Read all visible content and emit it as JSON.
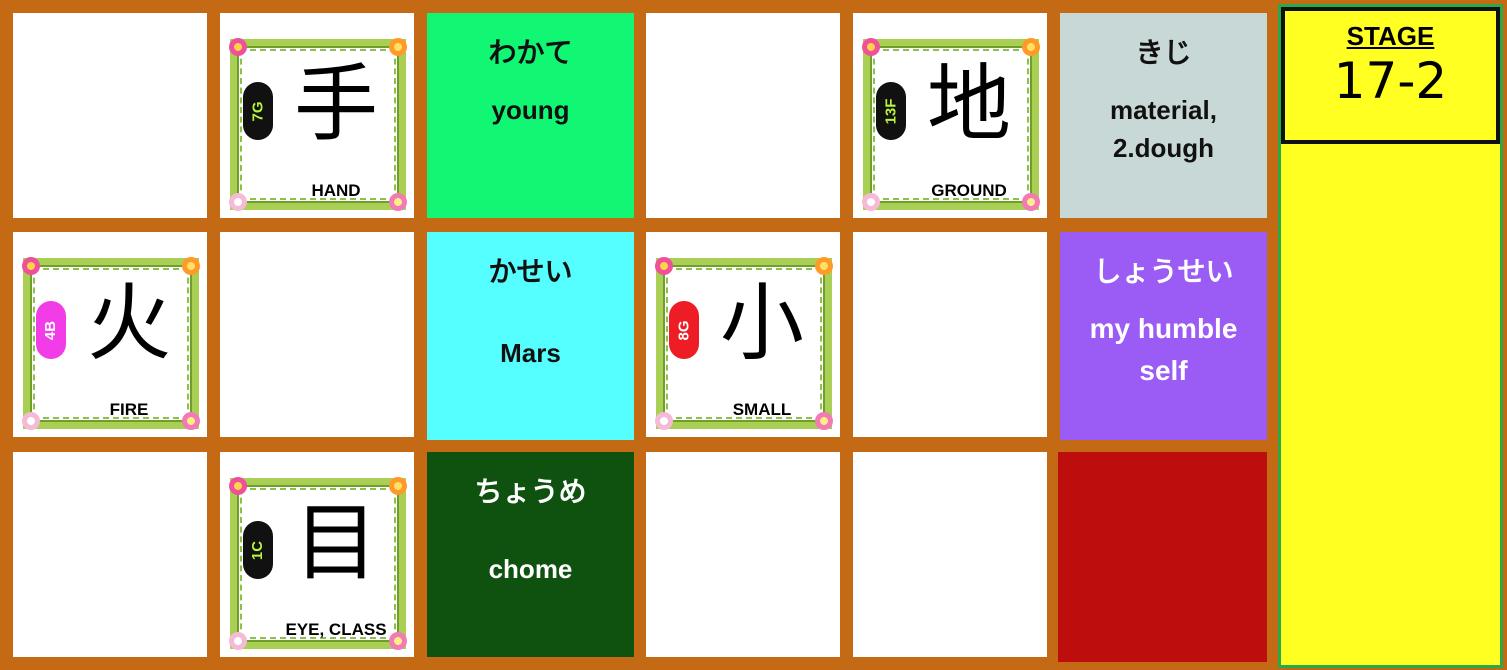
{
  "tiles": {
    "r0c2": {
      "kana": "わかて",
      "meaning": "young",
      "bg": "#11f774",
      "fg": "#111111"
    },
    "r0c5": {
      "kana": "きじ",
      "meaning": "material, 2.dough",
      "bg": "#c8d8d6",
      "fg": "#111111"
    },
    "r1c2": {
      "kana": "かせい",
      "meaning": "Mars",
      "bg": "#55ffff",
      "fg": "#111111"
    },
    "r1c5": {
      "kana": "しょうせい",
      "meaning": "my humble self",
      "bg": "#9b5cf6",
      "fg": "#ffffff"
    },
    "r2c2": {
      "kana": "ちょうめ",
      "meaning": "chome",
      "bg": "#0f520f",
      "fg": "#ffffff"
    },
    "r2c5": {
      "bg": "#bd0d0d"
    }
  },
  "kanji_cards": {
    "hand": {
      "kanji": "手",
      "label": "HAND",
      "grade": "7G",
      "badge_color": "#111111",
      "badge_text_color": "#b9f53b"
    },
    "ground": {
      "kanji": "地",
      "label": "GROUND",
      "grade": "13F",
      "badge_color": "#111111",
      "badge_text_color": "#b9f53b"
    },
    "fire": {
      "kanji": "火",
      "label": "FIRE",
      "grade": "4B",
      "badge_color": "#f23ce8",
      "badge_text_color": "#ffffff"
    },
    "small": {
      "kanji": "小",
      "label": "SMALL",
      "grade": "8G",
      "badge_color": "#ee1c24",
      "badge_text_color": "#ffffff"
    },
    "eye": {
      "kanji": "目",
      "label": "EYE, CLASS",
      "grade": "1C",
      "badge_color": "#111111",
      "badge_text_color": "#b9f53b"
    }
  },
  "stage": {
    "label": "STAGE",
    "number": "17-2"
  },
  "colors": {
    "board": "#c46a14",
    "stage_panel": "#ffff22",
    "stage_border": "#2aa84a"
  }
}
